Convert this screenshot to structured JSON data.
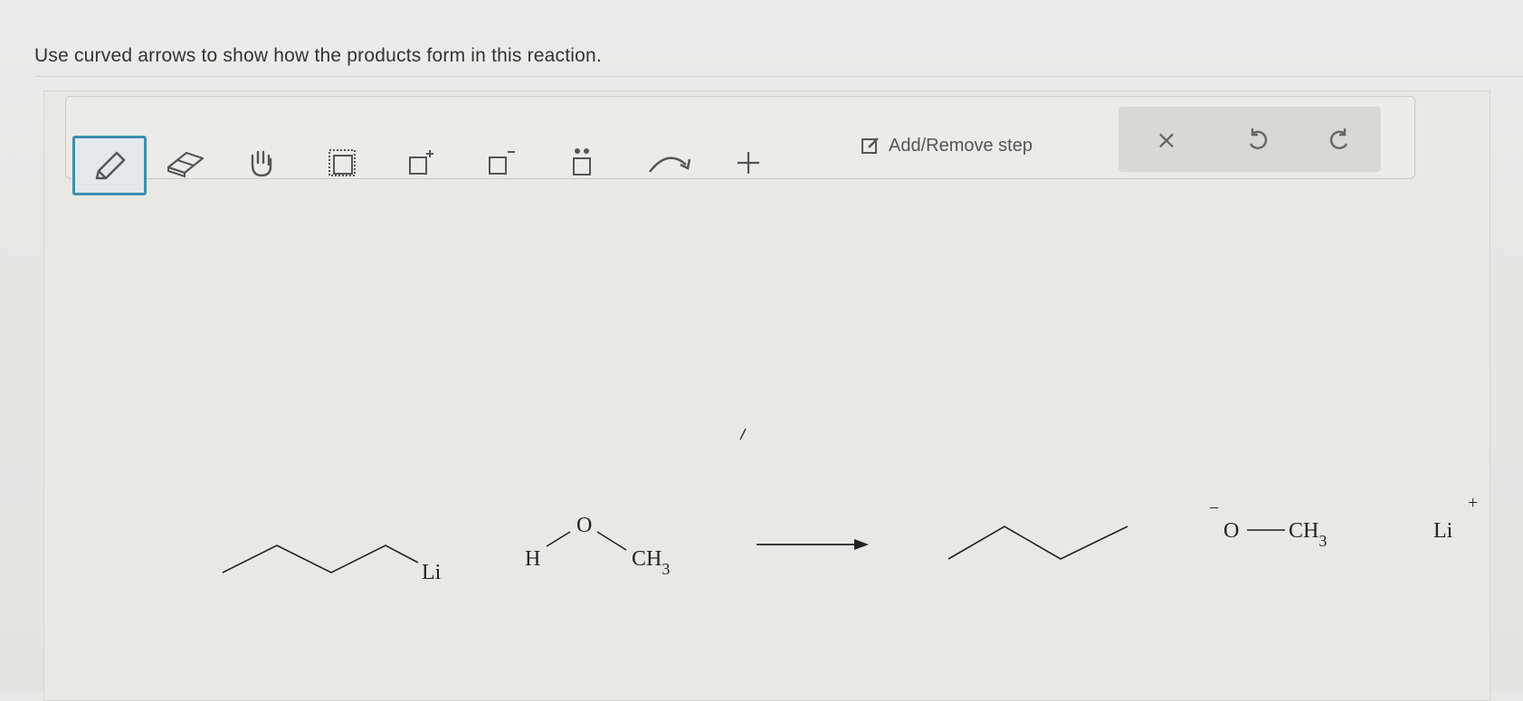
{
  "instruction": "Use curved arrows to show how the products form in this reaction.",
  "toolbar": {
    "tools": [
      {
        "name": "pencil-tool",
        "icon": "pencil-icon"
      },
      {
        "name": "eraser-tool",
        "icon": "eraser-icon"
      },
      {
        "name": "hand-tool",
        "icon": "hand-icon"
      },
      {
        "name": "selection-tool",
        "icon": "dotted-square-icon"
      },
      {
        "name": "positive-charge-tool",
        "icon": "square-plus-icon",
        "sup": "+"
      },
      {
        "name": "negative-charge-tool",
        "icon": "square-minus-icon",
        "sup": "−"
      },
      {
        "name": "lone-pair-tool",
        "icon": "square-dots-icon"
      },
      {
        "name": "curved-arrow-tool",
        "icon": "curved-arrow-icon"
      },
      {
        "name": "add-tool",
        "icon": "plus-icon"
      }
    ],
    "add_remove_step_label": "Add/Remove step",
    "clear_icon": "×",
    "undo_icon": "undo-icon",
    "redo_icon": "redo-icon"
  },
  "reaction": {
    "reactant1_label": "Li",
    "reactant2_h": "H",
    "reactant2_o": "O",
    "reactant2_ch": "CH",
    "reactant2_sub": "3",
    "product2_charge": "−",
    "product2_o": "O",
    "product2_ch": "CH",
    "product2_sub": "3",
    "product3_label": "Li",
    "product3_charge": "+"
  },
  "colors": {
    "accent": "#3c8fb0",
    "background": "#e7e7e5",
    "toolbar_bg": "#ebebe8",
    "right_group_bg": "#d8d8d5"
  }
}
